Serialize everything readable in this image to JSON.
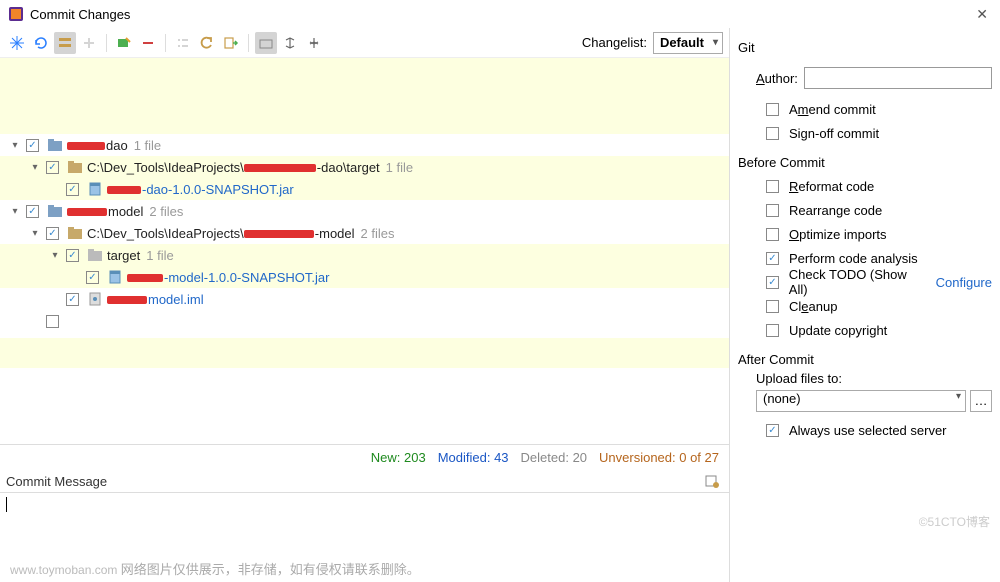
{
  "window": {
    "title": "Commit Changes"
  },
  "toolbar": {
    "changelist_label": "Changelist:",
    "changelist_value": "Default"
  },
  "tree": {
    "items": [
      {
        "level": 0,
        "chevron": "down",
        "checked": true,
        "type": "module",
        "redact_w": 38,
        "suffix": "dao",
        "count": "1 file",
        "highlight": false
      },
      {
        "level": 1,
        "chevron": "down",
        "checked": true,
        "type": "folder",
        "prefix": "C:\\Dev_Tools\\IdeaProjects\\",
        "redact_w": 72,
        "suffix": "-dao\\target",
        "count": "1 file",
        "highlight": true
      },
      {
        "level": 2,
        "chevron": "",
        "checked": true,
        "type": "jar",
        "redact_w": 34,
        "suffix": "-dao-1.0.0-SNAPSHOT.jar",
        "count": "",
        "highlight": true,
        "link": true
      },
      {
        "level": 0,
        "chevron": "down",
        "checked": true,
        "type": "module",
        "redact_w": 40,
        "suffix": "model",
        "count": "2 files",
        "highlight": false
      },
      {
        "level": 1,
        "chevron": "down",
        "checked": true,
        "type": "folder",
        "prefix": "C:\\Dev_Tools\\IdeaProjects\\",
        "redact_w": 70,
        "suffix": "-model",
        "count": "2 files",
        "highlight": false
      },
      {
        "level": 2,
        "chevron": "down",
        "checked": true,
        "type": "folder-plain",
        "text": "target",
        "count": "1 file",
        "highlight": true
      },
      {
        "level": 3,
        "chevron": "",
        "checked": true,
        "type": "jar",
        "redact_w": 36,
        "suffix": "-model-1.0.0-SNAPSHOT.jar",
        "count": "",
        "highlight": true,
        "link": true
      },
      {
        "level": 2,
        "chevron": "",
        "checked": true,
        "type": "iml",
        "redact_w": 40,
        "suffix": "model.iml",
        "count": "",
        "highlight": false,
        "link": true
      },
      {
        "level": 1,
        "chevron": "",
        "checked": false,
        "type": "empty",
        "text": "",
        "count": "",
        "highlight": false
      }
    ]
  },
  "stats": {
    "new": "New: 203",
    "modified": "Modified: 43",
    "deleted": "Deleted: 20",
    "unversioned": "Unversioned: 0 of 27"
  },
  "message": {
    "header": "Commit Message",
    "value": ""
  },
  "right": {
    "git_title": "Git",
    "author_label": "Author:",
    "author_value": "",
    "amend": {
      "label_pre": "A",
      "label_key": "m",
      "label_post": "end commit",
      "checked": false
    },
    "signoff": {
      "label": "Sign-off commit",
      "checked": false
    },
    "before_title": "Before Commit",
    "reformat": {
      "label_key": "R",
      "label_post": "eformat code",
      "checked": false
    },
    "rearrange": {
      "label": "Rearrange code",
      "checked": false
    },
    "optimize": {
      "label_key": "O",
      "label_post": "ptimize imports",
      "checked": false
    },
    "analysis": {
      "label": "Perform code analysis",
      "checked": true
    },
    "todo": {
      "label": "Check TODO (Show All)",
      "checked": true,
      "configure": "Configure"
    },
    "cleanup": {
      "label": "Cl",
      "label_key": "e",
      "label_post": "anup",
      "checked": false
    },
    "copyright": {
      "label": "Update copyright",
      "checked": false
    },
    "after_title": "After Commit",
    "upload_label": "Upload files to:",
    "upload_value": "(none)",
    "always_server": {
      "label": "Always use selected server",
      "checked": true
    }
  },
  "footer": {
    "url": "www.toymoban.com",
    "note": "网络图片仅供展示，非存储，如有侵权请联系删除。",
    "watermark": "©51CTO博客"
  }
}
